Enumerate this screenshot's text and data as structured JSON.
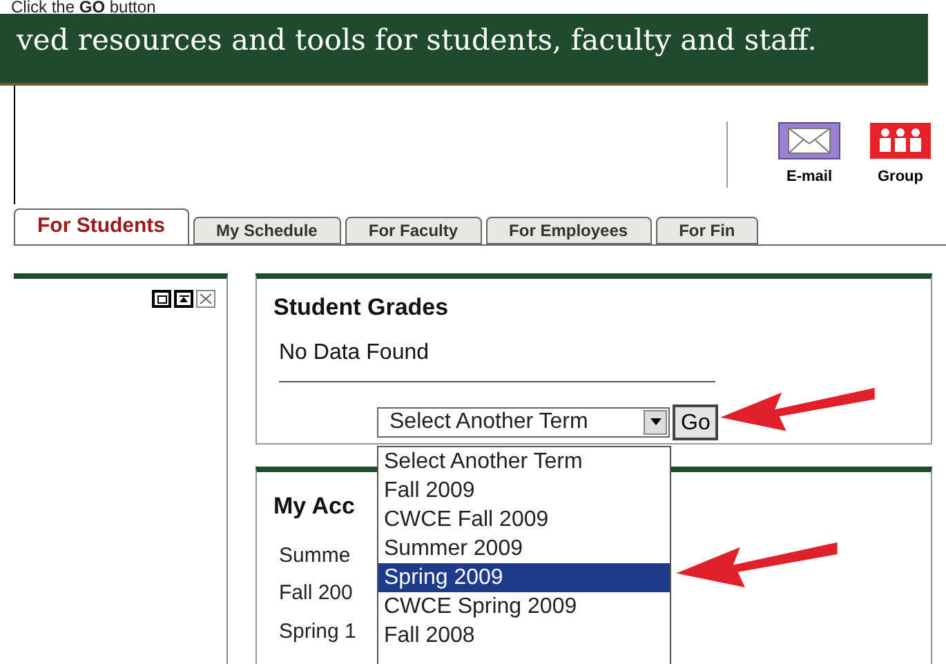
{
  "caption": {
    "prefix": "Click the",
    "bold": "GO",
    "suffix": "button"
  },
  "banner": {
    "text": "ved resources and tools for students, faculty and staff."
  },
  "toolbar": [
    {
      "label": "E-mail",
      "kind": "email"
    },
    {
      "label": "Group",
      "kind": "group"
    }
  ],
  "tabs": [
    {
      "label": "For Students",
      "selected": true
    },
    {
      "label": "My Schedule",
      "selected": false
    },
    {
      "label": "For Faculty",
      "selected": false
    },
    {
      "label": "For Employees",
      "selected": false
    },
    {
      "label": "For Fin",
      "selected": false
    }
  ],
  "grades": {
    "title": "Student Grades",
    "message": "No Data Found",
    "select": {
      "value": "Select Another Term",
      "expanded": true
    },
    "go": "Go",
    "options": [
      {
        "label": "Select Another Term",
        "selected": false
      },
      {
        "label": "Fall 2009",
        "selected": false
      },
      {
        "label": "CWCE Fall 2009",
        "selected": false
      },
      {
        "label": "Summer 2009",
        "selected": false
      },
      {
        "label": "Spring 2009",
        "selected": true
      },
      {
        "label": "CWCE Spring 2009",
        "selected": false
      },
      {
        "label": "Fall 2008",
        "selected": false
      }
    ]
  },
  "account": {
    "title": "My Acc",
    "items": [
      "Summe",
      "Fall 200",
      "Spring 1"
    ]
  }
}
